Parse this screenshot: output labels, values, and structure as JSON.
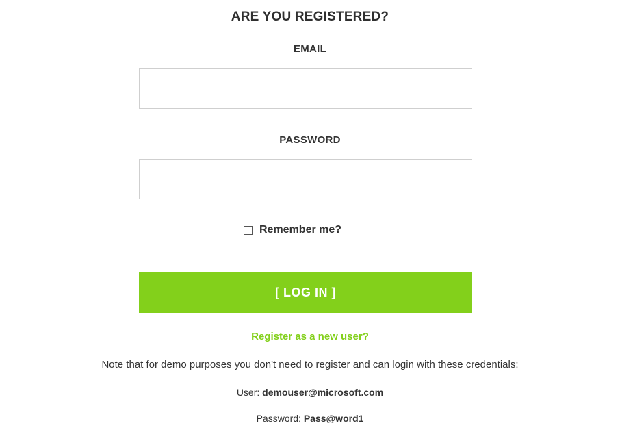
{
  "heading": "ARE YOU REGISTERED?",
  "email": {
    "label": "EMAIL",
    "value": "",
    "placeholder": ""
  },
  "password": {
    "label": "PASSWORD",
    "value": "",
    "placeholder": ""
  },
  "remember": {
    "label": "Remember me?",
    "checked": false
  },
  "login_button": "[ LOG IN ]",
  "register_link": "Register as a new user?",
  "note": "Note that for demo purposes you don't need to register and can login with these credentials:",
  "credentials": {
    "user_label": "User:",
    "user_value": "demouser@microsoft.com",
    "password_label": "Password:",
    "password_value": "Pass@word1"
  },
  "colors": {
    "accent": "#83d01b",
    "input_border": "#cfcfcf",
    "text": "#333333"
  }
}
